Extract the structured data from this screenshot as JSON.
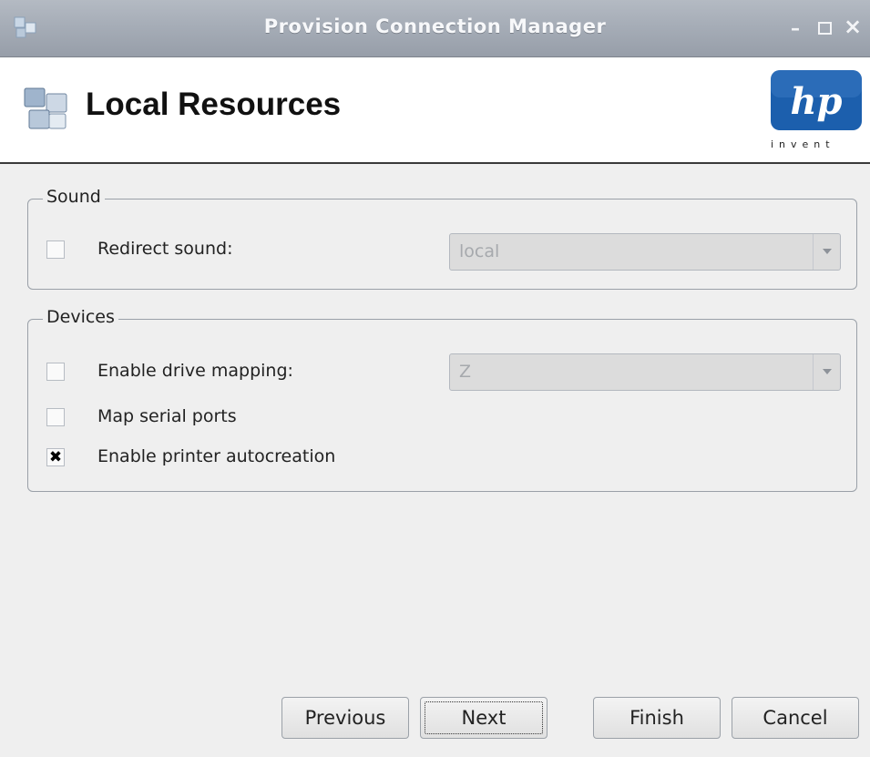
{
  "window": {
    "title": "Provision Connection Manager",
    "controls": {
      "minimize": "–",
      "maximize": "□",
      "close": "×"
    }
  },
  "header": {
    "title": "Local Resources",
    "logo_text": "hp",
    "logo_tagline": "invent",
    "logo_color": "#1c5fad"
  },
  "sound": {
    "legend": "Sound",
    "redirect_sound": {
      "label": "Redirect sound:",
      "checked": false,
      "value": "local"
    }
  },
  "devices": {
    "legend": "Devices",
    "drive_mapping": {
      "label": "Enable drive mapping:",
      "checked": false,
      "value": "Z"
    },
    "serial_ports": {
      "label": "Map serial ports",
      "checked": false
    },
    "printer_autocreation": {
      "label": "Enable printer autocreation",
      "checked": true,
      "mark": "✖"
    }
  },
  "buttons": {
    "previous": "Previous",
    "next": "Next",
    "finish": "Finish",
    "cancel": "Cancel"
  }
}
